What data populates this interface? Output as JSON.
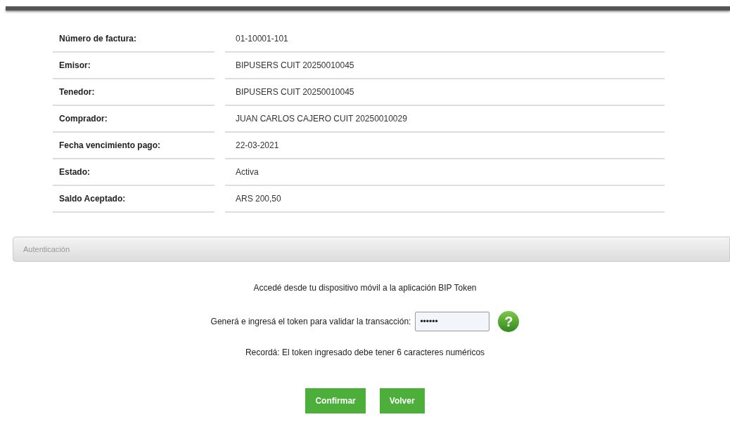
{
  "invoice": [
    {
      "label": "Número de factura:",
      "value": "01-10001-101"
    },
    {
      "label": "Emisor:",
      "value": "BIPUSERS CUIT 20250010045"
    },
    {
      "label": "Tenedor:",
      "value": "BIPUSERS CUIT 20250010045"
    },
    {
      "label": "Comprador:",
      "value": "JUAN CARLOS CAJERO CUIT 20250010029"
    },
    {
      "label": "Fecha vencimiento pago:",
      "value": "22-03-2021"
    },
    {
      "label": "Estado:",
      "value": "Activa"
    },
    {
      "label": "Saldo Aceptado:",
      "value": "ARS 200,50"
    }
  ],
  "auth": {
    "title": "Autenticación",
    "instruction": "Accedé desde tu dispositivo móvil a la aplicación BIP Token",
    "token_label": "Generá e ingresá el token para validar la transacción:",
    "token_value": "••••••",
    "help": "?",
    "reminder": "Recordá: El token ingresado debe tener 6 caracteres numéricos"
  },
  "buttons": [
    "Confirmar",
    "Volver"
  ]
}
